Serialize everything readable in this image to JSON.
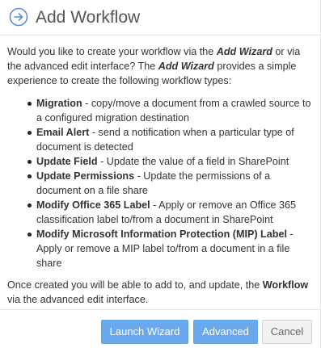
{
  "dialog": {
    "title": "Add Workflow",
    "icon": "arrow-right-circle-icon",
    "accent_color": "#5a8fd6"
  },
  "body": {
    "intro": {
      "part1": "Would you like to create your workflow via the ",
      "wizard_name": "Add Wizard",
      "part2": " or via the advanced edit interface? The ",
      "wizard_name_2": "Add Wizard",
      "part3": " provides a simple experience to create the following workflow types:"
    },
    "types": [
      {
        "name": "Migration",
        "description": " - copy/move a document from a crawled source to a configured migration destination"
      },
      {
        "name": "Email Alert",
        "description": " - send a notification when a particular type of document is detected"
      },
      {
        "name": "Update Field",
        "description": " - Update the value of a field in SharePoint"
      },
      {
        "name": "Update Permissions",
        "description": " - Update the permissions of a document on a file share"
      },
      {
        "name": "Modify Office 365 Label",
        "description": " - Apply or remove an Office 365 classification label to/from a document in SharePoint"
      },
      {
        "name": "Modify Microsoft Information Protection (MIP) Label",
        "description": " - Apply or remove a MIP label to/from a document in a file share"
      }
    ],
    "outro": {
      "part1": "Once created you will be able to add to, and update, the ",
      "workflow_word": "Workflow",
      "part2": " via the advanced edit interface."
    }
  },
  "footer": {
    "launch_wizard_label": "Launch Wizard",
    "advanced_label": "Advanced",
    "cancel_label": "Cancel",
    "primary_color": "#6aa9ee"
  }
}
